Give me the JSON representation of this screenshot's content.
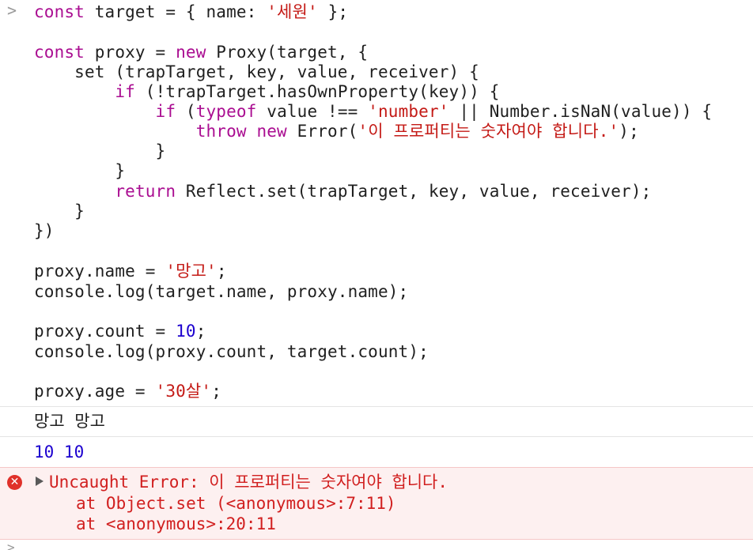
{
  "prompt_symbol": ">",
  "code": {
    "l1": {
      "a": "const",
      "b": " target = { name: ",
      "c": "'세원'",
      "d": " };"
    },
    "l2": {
      "a": "const",
      "b": " proxy = ",
      "c": "new",
      "d": " Proxy(target, {"
    },
    "l3": {
      "a": "    set (trapTarget, key, value, receiver) {"
    },
    "l4": {
      "a": "        ",
      "b": "if",
      "c": " (!trapTarget.hasOwnProperty(key)) {"
    },
    "l5": {
      "a": "            ",
      "b": "if",
      "c": " (",
      "d": "typeof",
      "e": " value !== ",
      "f": "'number'",
      "g": " || Number.isNaN(value)) {"
    },
    "l6": {
      "a": "                ",
      "b": "throw",
      "c": " ",
      "d": "new",
      "e": " Error(",
      "f": "'이 프로퍼티는 숫자여야 합니다.'",
      "g": ");"
    },
    "l7": {
      "a": "            }"
    },
    "l8": {
      "a": "        }"
    },
    "l9": {
      "a": "        ",
      "b": "return",
      "c": " Reflect.set(trapTarget, key, value, receiver);"
    },
    "l10": {
      "a": "    }"
    },
    "l11": {
      "a": "})"
    },
    "l12": {
      "a": "proxy.name = ",
      "b": "'망고'",
      "c": ";"
    },
    "l13": {
      "a": "console.log(target.name, proxy.name);"
    },
    "l14": {
      "a": "proxy.count = ",
      "b": "10",
      "c": ";"
    },
    "l15": {
      "a": "console.log(proxy.count, target.count);"
    },
    "l16": {
      "a": "proxy.age = ",
      "b": "'30살'",
      "c": ";"
    }
  },
  "outputs": {
    "log1": "망고 망고",
    "log2": "10 10"
  },
  "error": {
    "icon": "✕",
    "message": "Uncaught Error: 이 프로퍼티는 숫자여야 합니다.",
    "frame1": "at Object.set (<anonymous>:7:11)",
    "frame2": "at <anonymous>:20:11"
  },
  "colors": {
    "keyword": "#aa0d91",
    "string": "#c41a16",
    "number": "#1c00cf",
    "error_text": "#d11f1f",
    "error_bg": "#fdf0f0"
  }
}
